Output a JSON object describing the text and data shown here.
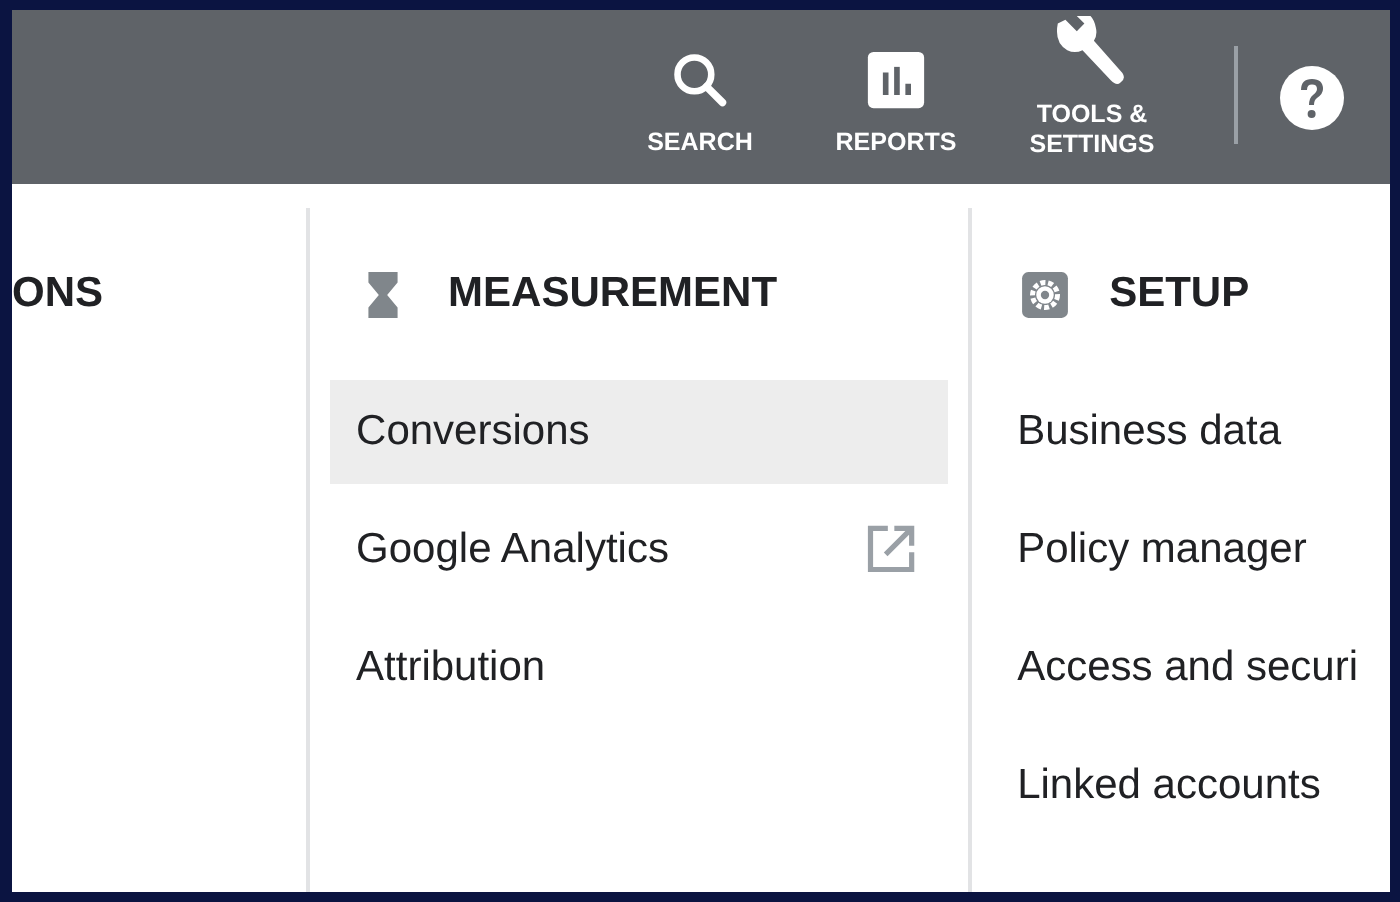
{
  "top_bar": {
    "actions": [
      {
        "kind": "search",
        "label": "SEARCH"
      },
      {
        "kind": "reports",
        "label": "REPORTS"
      },
      {
        "kind": "tools",
        "label": "TOOLS & SETTINGS"
      }
    ],
    "help": {
      "kind": "help"
    }
  },
  "columns": [
    {
      "title": "ONS"
    },
    {
      "title": "MEASUREMENT",
      "items": [
        {
          "label": "Conversions",
          "selected": true,
          "external": false
        },
        {
          "label": "Google Analytics",
          "selected": false,
          "external": true
        },
        {
          "label": "Attribution",
          "selected": false,
          "external": false
        }
      ]
    },
    {
      "title": "SETUP",
      "items": [
        {
          "label": "Business data",
          "selected": false,
          "external": false
        },
        {
          "label": "Policy manager",
          "selected": false,
          "external": false
        },
        {
          "label": "Access and securi",
          "selected": false,
          "external": false
        },
        {
          "label": "Linked accounts",
          "selected": false,
          "external": false
        }
      ]
    }
  ]
}
